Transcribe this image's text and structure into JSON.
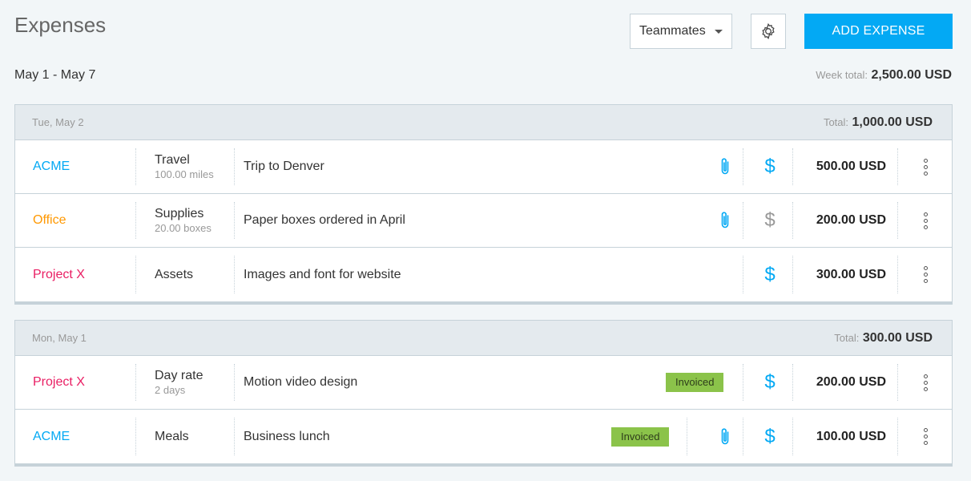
{
  "header": {
    "title": "Expenses",
    "teammates_label": "Teammates",
    "add_label": "ADD EXPENSE",
    "date_range": "May 1 - May 7",
    "week_total_label": "Week total:",
    "week_total_value": "2,500.00 USD"
  },
  "colors": {
    "accent": "#03a9f4",
    "acme": "#03a9f4",
    "office": "#ff9800",
    "project_x": "#e91e63",
    "invoiced": "#8bc34a"
  },
  "days": [
    {
      "date": "Tue, May 2",
      "total_label": "Total:",
      "total_value": "1,000.00 USD",
      "rows": [
        {
          "project": "ACME",
          "project_color": "#03a9f4",
          "category": "Travel",
          "quantity": "100.00 miles",
          "description": "Trip to Denver",
          "invoiced": false,
          "attachment": true,
          "billable": true,
          "amount": "500.00 USD"
        },
        {
          "project": "Office",
          "project_color": "#ff9800",
          "category": "Supplies",
          "quantity": "20.00 boxes",
          "description": "Paper boxes ordered in April",
          "invoiced": false,
          "attachment": true,
          "billable": false,
          "amount": "200.00 USD"
        },
        {
          "project": "Project X",
          "project_color": "#e91e63",
          "category": "Assets",
          "quantity": "",
          "description": "Images and font for website",
          "invoiced": false,
          "attachment": false,
          "billable": true,
          "amount": "300.00 USD"
        }
      ]
    },
    {
      "date": "Mon, May 1",
      "total_label": "Total:",
      "total_value": "300.00 USD",
      "rows": [
        {
          "project": "Project X",
          "project_color": "#e91e63",
          "category": "Day rate",
          "quantity": "2 days",
          "description": "Motion video design",
          "invoiced": true,
          "invoiced_label": "Invoiced",
          "attachment": false,
          "billable": true,
          "amount": "200.00 USD"
        },
        {
          "project": "ACME",
          "project_color": "#03a9f4",
          "category": "Meals",
          "quantity": "",
          "description": "Business lunch",
          "invoiced": true,
          "invoiced_label": "Invoiced",
          "attachment": true,
          "billable": true,
          "amount": "100.00 USD"
        }
      ]
    }
  ],
  "icons": {
    "settings": "gear-icon",
    "attachment": "paperclip-icon",
    "billable": "dollar-icon",
    "menu": "kebab-menu-icon",
    "dropdown": "chevron-down-icon"
  }
}
